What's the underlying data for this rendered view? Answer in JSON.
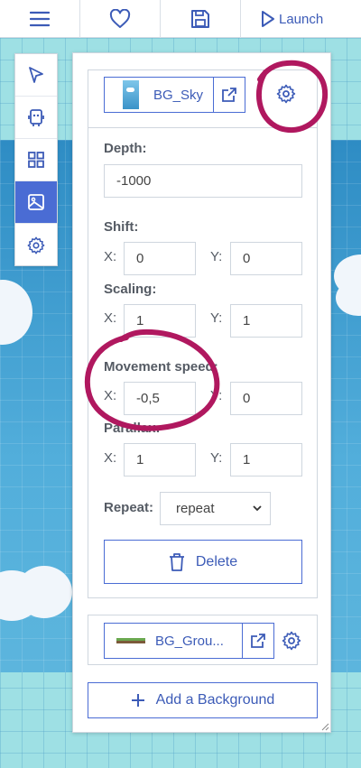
{
  "toolbar": {
    "menu_icon": "hamburger-icon",
    "favorite_icon": "heart-icon",
    "save_icon": "floppy-disk-icon",
    "launch_label": "Launch"
  },
  "tools": [
    {
      "name": "select",
      "icon": "cursor-icon",
      "active": false
    },
    {
      "name": "entities",
      "icon": "robot-icon",
      "active": false
    },
    {
      "name": "tiles",
      "icon": "grid-icon",
      "active": false
    },
    {
      "name": "backgrounds",
      "icon": "image-icon",
      "active": true
    },
    {
      "name": "settings",
      "icon": "gear-icon",
      "active": false
    }
  ],
  "background1": {
    "asset_name": "BG_Sky",
    "depth_label": "Depth:",
    "depth_value": "-1000",
    "shift_label": "Shift:",
    "shift_x": "0",
    "shift_y": "0",
    "scaling_label": "Scaling:",
    "scaling_x": "1",
    "scaling_y": "1",
    "movement_label": "Movement speed:",
    "movement_x": "-0,5",
    "movement_y": "0",
    "parallax_label": "Parallax:",
    "parallax_x": "1",
    "parallax_y": "1",
    "repeat_label": "Repeat:",
    "repeat_value": "repeat",
    "delete_label": "Delete",
    "x_label": "X:",
    "y_label": "Y:"
  },
  "background2": {
    "asset_name": "BG_Grou..."
  },
  "add_background_label": "Add a Background",
  "colors": {
    "accent": "#4a6cd4",
    "annotation": "#b0185f"
  }
}
